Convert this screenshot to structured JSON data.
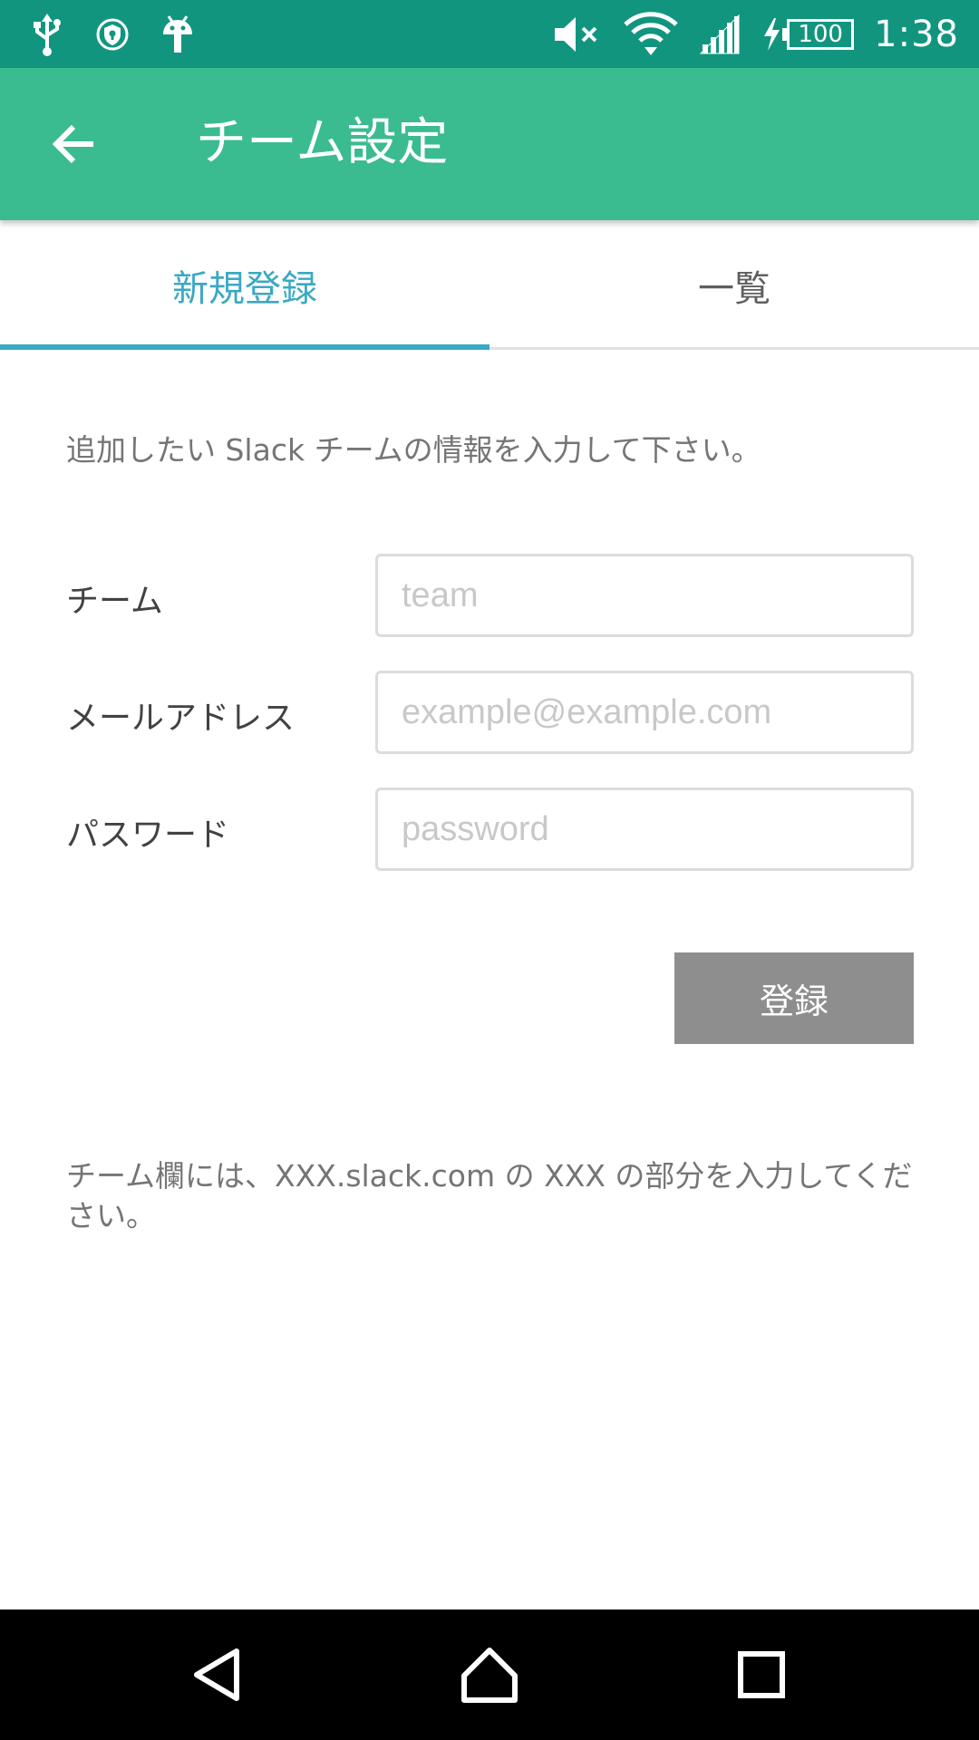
{
  "status_bar": {
    "time": "1:38",
    "battery_level": "100",
    "background_color": "#12957f",
    "icons_left": [
      "usb-icon",
      "vpn-shield-icon",
      "android-debug-icon"
    ],
    "icons_right": [
      "volume-muted-icon",
      "wifi-icon",
      "cellular-signal-icon",
      "charging-bolt-icon",
      "battery-icon"
    ]
  },
  "app_bar": {
    "title": "チーム設定",
    "back_icon": "arrow-back-icon",
    "background_color": "#3bbb90"
  },
  "tabs": [
    {
      "label": "新規登録",
      "selected": true
    },
    {
      "label": "一覧",
      "selected": false
    }
  ],
  "tab_accent_color": "#3aa9c3",
  "form": {
    "intro": "追加したい Slack チームの情報を入力して下さい。",
    "team": {
      "label": "チーム",
      "value": "",
      "placeholder": "team"
    },
    "email": {
      "label": "メールアドレス",
      "value": "",
      "placeholder": "example@example.com"
    },
    "password": {
      "label": "パスワード",
      "value": "",
      "placeholder": "password"
    },
    "submit_label": "登録",
    "submit_color": "#8e8e8e",
    "note": "チーム欄には、XXX.slack.com の XXX の部分を入力してください。"
  },
  "nav_bar": {
    "buttons": [
      "nav-back-icon",
      "nav-home-icon",
      "nav-recents-icon"
    ]
  }
}
